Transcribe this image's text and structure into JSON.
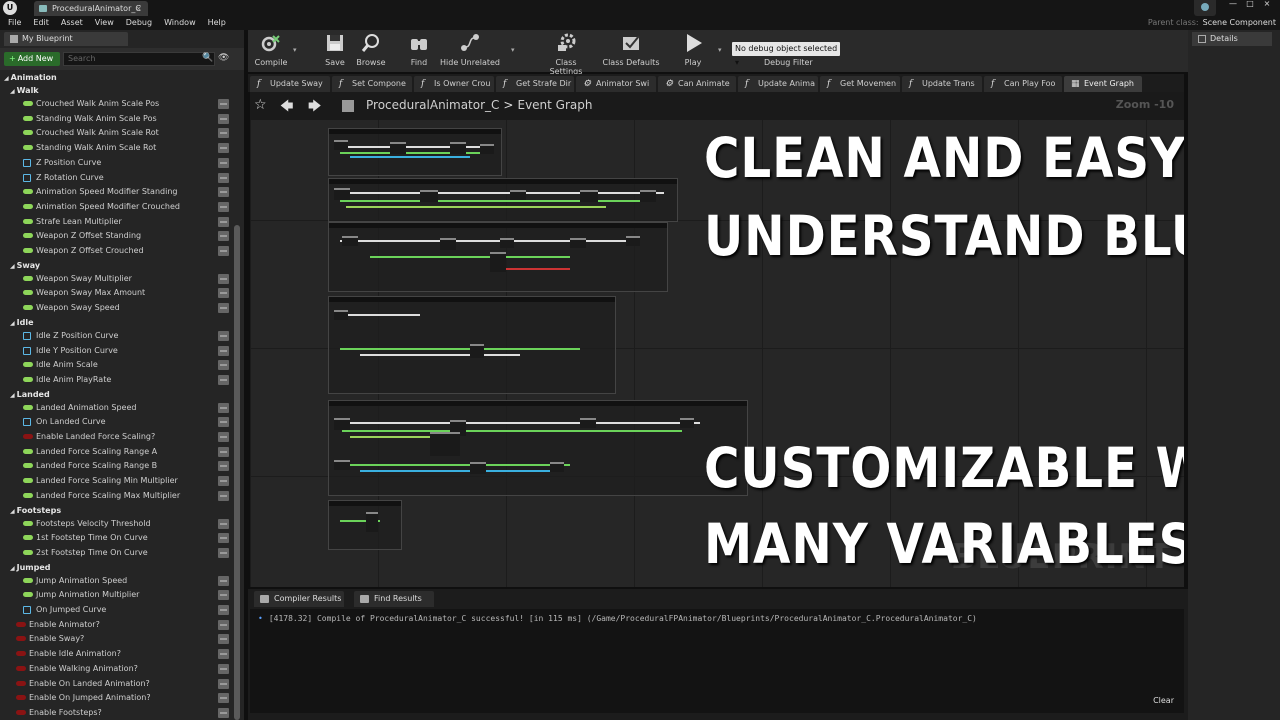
{
  "window": {
    "tab_title": "ProceduralAnimator_C",
    "logo_text": "U",
    "tab_close": "×",
    "controls": [
      "—",
      "□",
      "×"
    ]
  },
  "menu": [
    "File",
    "Edit",
    "Asset",
    "View",
    "Debug",
    "Window",
    "Help"
  ],
  "parent_class": {
    "label": "Parent class:",
    "value": "Scene Component"
  },
  "left_panel": {
    "tab": "My Blueprint",
    "add_new": "Add New",
    "add_new_plus": "+",
    "search_placeholder": "Search",
    "search_icon": "🔍",
    "view_icon": "👁"
  },
  "variables": [
    {
      "kind": "cat",
      "label": "Animation",
      "indent": 0
    },
    {
      "kind": "cat",
      "label": "Walk",
      "indent": 1
    },
    {
      "kind": "var",
      "type": "float",
      "label": "Crouched Walk Anim Scale Pos"
    },
    {
      "kind": "var",
      "type": "float",
      "label": "Standing Walk Anim Scale Pos"
    },
    {
      "kind": "var",
      "type": "float",
      "label": "Crouched Walk Anim Scale Rot"
    },
    {
      "kind": "var",
      "type": "float",
      "label": "Standing Walk Anim Scale Rot"
    },
    {
      "kind": "var",
      "type": "curve",
      "label": "Z Position Curve"
    },
    {
      "kind": "var",
      "type": "curve",
      "label": "Z Rotation Curve"
    },
    {
      "kind": "var",
      "type": "float",
      "label": "Animation Speed Modifier Standing"
    },
    {
      "kind": "var",
      "type": "float",
      "label": "Animation Speed Modifier Crouched"
    },
    {
      "kind": "var",
      "type": "float",
      "label": "Strafe Lean Multiplier"
    },
    {
      "kind": "var",
      "type": "float",
      "label": "Weapon Z Offset Standing"
    },
    {
      "kind": "var",
      "type": "float",
      "label": "Weapon Z Offset Crouched"
    },
    {
      "kind": "cat",
      "label": "Sway",
      "indent": 1
    },
    {
      "kind": "var",
      "type": "float",
      "label": "Weapon Sway Multiplier"
    },
    {
      "kind": "var",
      "type": "float",
      "label": "Weapon Sway Max Amount"
    },
    {
      "kind": "var",
      "type": "float",
      "label": "Weapon Sway Speed"
    },
    {
      "kind": "cat",
      "label": "Idle",
      "indent": 1
    },
    {
      "kind": "var",
      "type": "curve",
      "label": "Idle Z Position Curve"
    },
    {
      "kind": "var",
      "type": "curve",
      "label": "Idle Y Position Curve"
    },
    {
      "kind": "var",
      "type": "float",
      "label": "Idle Anim Scale"
    },
    {
      "kind": "var",
      "type": "float",
      "label": "Idle Anim PlayRate"
    },
    {
      "kind": "cat",
      "label": "Landed",
      "indent": 1
    },
    {
      "kind": "var",
      "type": "float",
      "label": "Landed Animation Speed"
    },
    {
      "kind": "var",
      "type": "curve",
      "label": "On Landed Curve"
    },
    {
      "kind": "var",
      "type": "bool",
      "label": "Enable Landed Force Scaling?"
    },
    {
      "kind": "var",
      "type": "float",
      "label": "Landed Force Scaling Range A"
    },
    {
      "kind": "var",
      "type": "float",
      "label": "Landed Force Scaling Range B"
    },
    {
      "kind": "var",
      "type": "float",
      "label": "Landed Force Scaling Min Multiplier"
    },
    {
      "kind": "var",
      "type": "float",
      "label": "Landed Force Scaling Max Multiplier"
    },
    {
      "kind": "cat",
      "label": "Footsteps",
      "indent": 1
    },
    {
      "kind": "var",
      "type": "float",
      "label": "Footsteps Velocity Threshold"
    },
    {
      "kind": "var",
      "type": "float",
      "label": "1st Footstep Time On Curve"
    },
    {
      "kind": "var",
      "type": "float",
      "label": "2st Footstep Time On Curve"
    },
    {
      "kind": "cat",
      "label": "Jumped",
      "indent": 1
    },
    {
      "kind": "var",
      "type": "float",
      "label": "Jump Animation Speed"
    },
    {
      "kind": "var",
      "type": "float",
      "label": "Jump Animation Multiplier"
    },
    {
      "kind": "var",
      "type": "curve",
      "label": "On Jumped Curve"
    },
    {
      "kind": "top",
      "type": "bool",
      "label": "Enable Animator?"
    },
    {
      "kind": "top",
      "type": "bool",
      "label": "Enable Sway?"
    },
    {
      "kind": "top",
      "type": "bool",
      "label": "Enable Idle Animation?"
    },
    {
      "kind": "top",
      "type": "bool",
      "label": "Enable Walking Animation?"
    },
    {
      "kind": "top",
      "type": "bool",
      "label": "Enable On Landed Animation?"
    },
    {
      "kind": "top",
      "type": "bool",
      "label": "Enable On Jumped Animation?"
    },
    {
      "kind": "top",
      "type": "bool",
      "label": "Enable Footsteps?"
    }
  ],
  "toolbar": {
    "compile": "Compile",
    "save": "Save",
    "browse": "Browse",
    "find": "Find",
    "hide_unrelated": "Hide Unrelated",
    "class_settings": "Class Settings",
    "class_defaults": "Class Defaults",
    "play": "Play",
    "debug_object": "No debug object selected",
    "debug_filter": "Debug Filter",
    "caret": "▾"
  },
  "details": {
    "tab": "Details"
  },
  "function_tabs": [
    {
      "label": "Update Sway",
      "icon": "f"
    },
    {
      "label": "Set Compone",
      "icon": "f"
    },
    {
      "label": "Is Owner Crou",
      "icon": "f"
    },
    {
      "label": "Get Strafe Dir",
      "icon": "f"
    },
    {
      "label": "Animator Swi",
      "icon": "gear"
    },
    {
      "label": "Can Animate",
      "icon": "gear"
    },
    {
      "label": "Update Anima",
      "icon": "f"
    },
    {
      "label": "Get Movemen",
      "icon": "f"
    },
    {
      "label": "Update Trans",
      "icon": "f"
    },
    {
      "label": "Can Play Foo",
      "icon": "f"
    },
    {
      "label": "Event Graph",
      "icon": "grid",
      "active": true
    }
  ],
  "graph": {
    "star": "☆",
    "back": "🡄",
    "forward": "🡆",
    "breadcrumb_class": "ProceduralAnimator_C",
    "breadcrumb_sep": ">",
    "breadcrumb_graph": "Event Graph",
    "zoom": "Zoom -10",
    "watermark": "BLUEPRINT",
    "overlay_lines": [
      "CLEAN AND EASY TO",
      "UNDERSTAND BLUEPRINT",
      "CUSTOMIZABLE WITH",
      "MANY VARIABLES!"
    ]
  },
  "bottom": {
    "tabs": [
      "Compiler Results",
      "Find Results"
    ],
    "log_bullet": "•",
    "log": "[4178.32] Compile of ProceduralAnimator_C successful! [in 115 ms] (/Game/ProceduralFPAnimator/Blueprints/ProceduralAnimator_C.ProceduralAnimator_C)",
    "clear": "Clear"
  },
  "colors": {
    "float_pin": "#8ed65a",
    "bool_pin": "#8a1313",
    "curve_pin": "#5cb8e6",
    "add_new": "#2a6b2a",
    "log_bullet": "#5aa0ff"
  }
}
